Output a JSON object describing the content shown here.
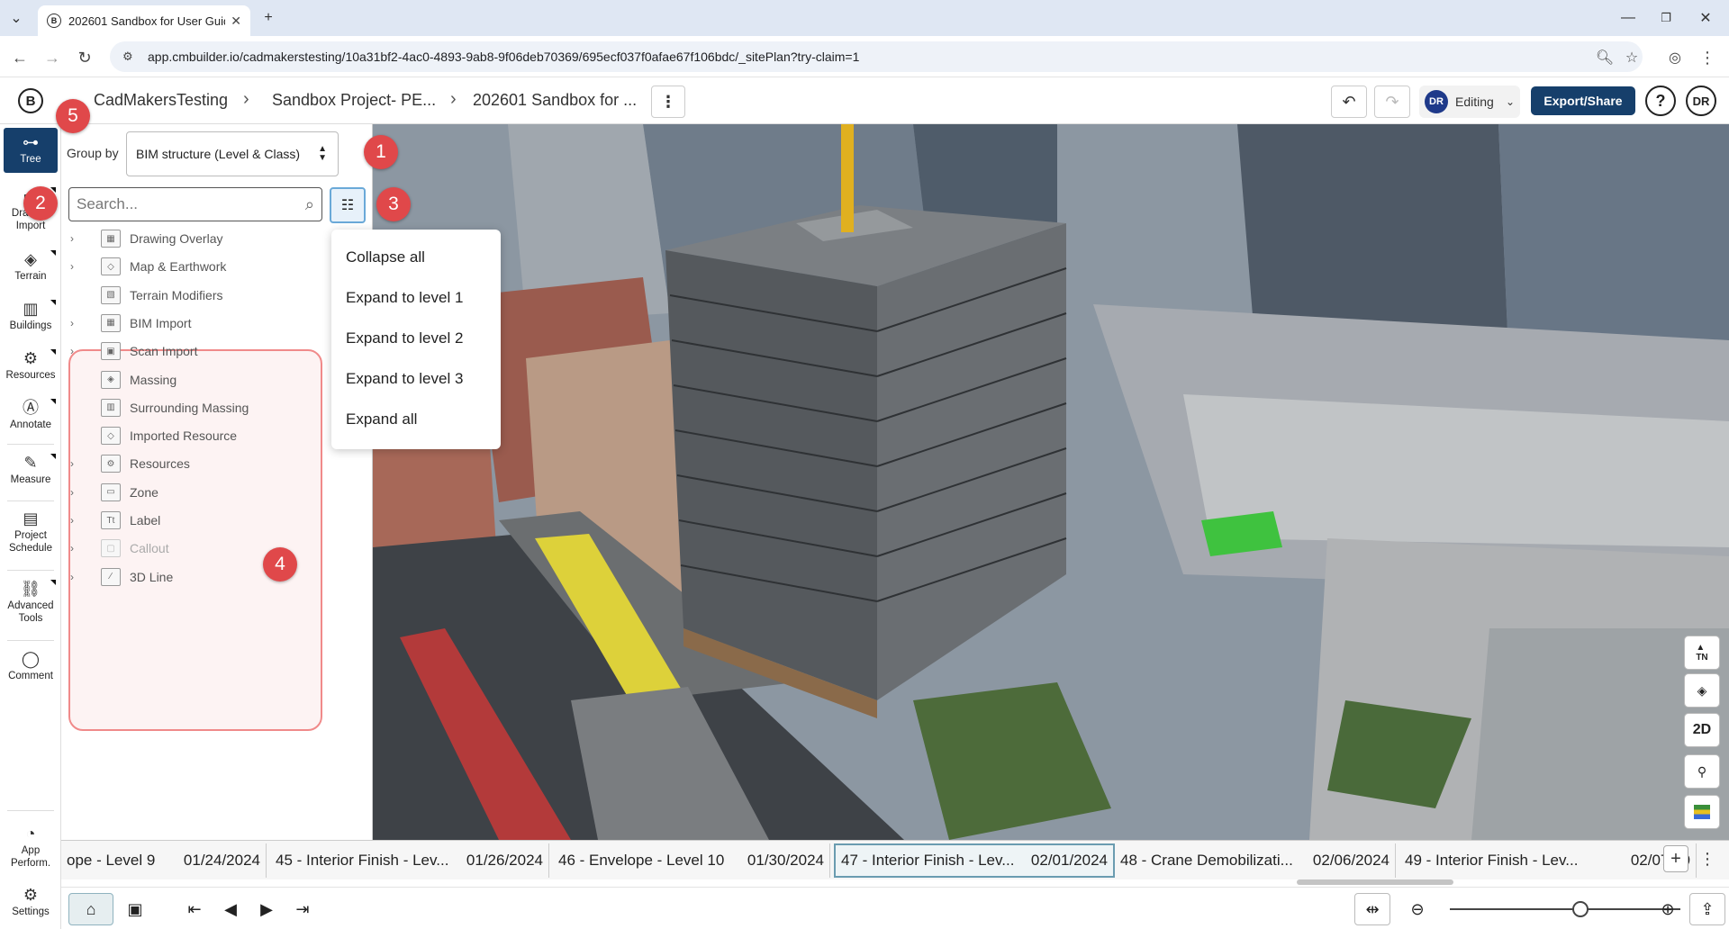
{
  "browser": {
    "tab_title": "202601 Sandbox for User Guide",
    "url": "app.cmbuilder.io/cadmakerstesting/10a31bf2-4ac0-4893-9ab8-9f06deb70369/695ecf037f0afae67f106bdc/_sitePlan?try-claim=1"
  },
  "header": {
    "breadcrumbs": [
      "CadMakersTesting",
      "Sandbox Project- PE...",
      "202601 Sandbox for ..."
    ],
    "mode_initials": "DR",
    "mode_label": "Editing",
    "export_label": "Export/Share",
    "help_label": "?",
    "user_initials": "DR"
  },
  "leftnav": {
    "items": [
      {
        "label": "Tree",
        "icon": "tree-icon"
      },
      {
        "label": "Drawing Import",
        "icon": "drawing-import-icon"
      },
      {
        "label": "Terrain",
        "icon": "terrain-icon"
      },
      {
        "label": "Buildings",
        "icon": "buildings-icon"
      },
      {
        "label": "Resources",
        "icon": "resources-icon"
      },
      {
        "label": "Annotate",
        "icon": "annotate-icon"
      },
      {
        "label": "Measure",
        "icon": "measure-icon"
      },
      {
        "label": "Project Schedule",
        "icon": "project-schedule-icon"
      },
      {
        "label": "Advanced Tools",
        "icon": "advanced-tools-icon"
      },
      {
        "label": "Comment",
        "icon": "comment-icon"
      },
      {
        "label": "App Perform.",
        "icon": "app-performance-icon"
      },
      {
        "label": "Settings",
        "icon": "gear-icon"
      }
    ]
  },
  "panel": {
    "group_by_label": "Group by",
    "group_by_value": "BIM structure (Level & Class)",
    "search_placeholder": "Search...",
    "tree_items": [
      {
        "label": "Drawing Overlay",
        "expandable": true
      },
      {
        "label": "Map & Earthwork",
        "expandable": true
      },
      {
        "label": "Terrain Modifiers",
        "expandable": false
      },
      {
        "label": "BIM Import",
        "expandable": true
      },
      {
        "label": "Scan Import",
        "expandable": true
      },
      {
        "label": "Massing",
        "expandable": false
      },
      {
        "label": "Surrounding Massing",
        "expandable": false
      },
      {
        "label": "Imported Resource",
        "expandable": false
      },
      {
        "label": "Resources",
        "expandable": true
      },
      {
        "label": "Zone",
        "expandable": true
      },
      {
        "label": "Label",
        "expandable": true
      },
      {
        "label": "Callout",
        "expandable": true,
        "dimmed": true
      },
      {
        "label": "3D Line",
        "expandable": true
      }
    ]
  },
  "menu": {
    "items": [
      "Collapse all",
      "Expand to level 1",
      "Expand to level 2",
      "Expand to level 3",
      "Expand all"
    ]
  },
  "viewport_controls": [
    "TN",
    "layers-icon",
    "2D",
    "pin-icon",
    "legend-icon"
  ],
  "timeline": {
    "items": [
      {
        "label": "ope - Level 9",
        "date": "01/24/2024"
      },
      {
        "label": "45 - Interior Finish - Lev...",
        "date": "01/26/2024"
      },
      {
        "label": "46 - Envelope - Level 10",
        "date": "01/30/2024"
      },
      {
        "label": "47 - Interior Finish - Lev...",
        "date": "02/01/2024",
        "active": true
      },
      {
        "label": "48 - Crane Demobilizati...",
        "date": "02/06/2024"
      },
      {
        "label": "49 - Interior Finish - Lev...",
        "date": "02/07/20"
      }
    ],
    "add_label": "+",
    "more_label": "⋮"
  },
  "annotations": [
    "1",
    "2",
    "3",
    "4",
    "5"
  ],
  "colors": {
    "accent": "#163f6b",
    "badge": "#e0484a",
    "highlight": "#f08a8a",
    "active_timeline": "#6a9cb0"
  }
}
